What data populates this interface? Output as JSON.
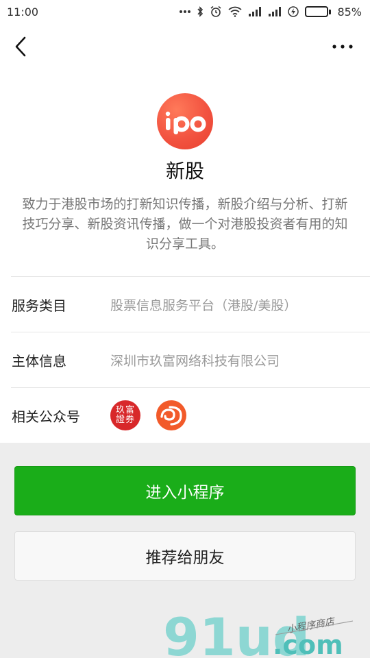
{
  "status_bar": {
    "time": "11:00",
    "battery_percent": "85%",
    "battery_level": 0.85,
    "icons": [
      "more-dots-icon",
      "bluetooth-icon",
      "alarm-icon",
      "wifi-icon",
      "signal-icon",
      "signal-icon",
      "charging-icon",
      "battery-icon"
    ]
  },
  "nav": {
    "back_icon": "back-chevron-icon",
    "more_icon": "more-icon"
  },
  "app": {
    "logo_text": "ipo",
    "name": "新股",
    "description": "致力于港股市场的打新知识传播，新股介绍与分析、打新技巧分享、新股资讯传播，做一个对港股投资者有用的知识分享工具。"
  },
  "info": {
    "category_label": "服务类目",
    "category_value": "股票信息服务平台（港股/美股）",
    "entity_label": "主体信息",
    "entity_value": "深圳市玖富网络科技有限公司",
    "accounts_label": "相关公众号",
    "account1_text": "玖富證券"
  },
  "actions": {
    "enter_label": "进入小程序",
    "share_label": "推荐给朋友"
  },
  "watermark": {
    "brand": "91ud",
    "domain": ".com",
    "tagline": "小程序商店"
  },
  "colors": {
    "primary_green": "#1aad19",
    "logo_red": "#f25340"
  }
}
